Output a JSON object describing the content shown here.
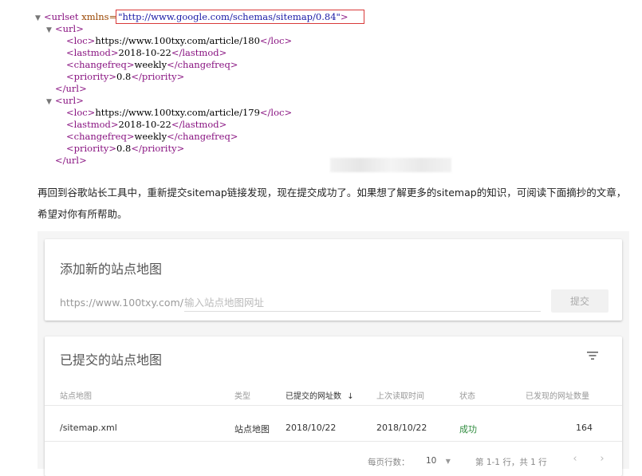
{
  "xml": {
    "lines": [
      {
        "tri": "▼",
        "open": "<urlset ",
        "attr": "xmlns=",
        "val": "\"http://www.google.com/schemas/sitemap/0.84\"",
        "close": ">",
        "text": ""
      },
      {
        "tri": "▼",
        "open": "<url>",
        "text": "",
        "close": ""
      },
      {
        "tri": "",
        "open": "<loc>",
        "text": "https://www.100txy.com/article/180",
        "close": "</loc>"
      },
      {
        "tri": "",
        "open": "<lastmod>",
        "text": "2018-10-22",
        "close": "</lastmod>"
      },
      {
        "tri": "",
        "open": "<changefreq>",
        "text": "weekly",
        "close": "</changefreq>"
      },
      {
        "tri": "",
        "open": "<priority>",
        "text": "0.8",
        "close": "</priority>"
      },
      {
        "tri": "",
        "open": "</url>",
        "text": "",
        "close": ""
      },
      {
        "tri": "▼",
        "open": "<url>",
        "text": "",
        "close": ""
      },
      {
        "tri": "",
        "open": "<loc>",
        "text": "https://www.100txy.com/article/179",
        "close": "</loc>"
      },
      {
        "tri": "",
        "open": "<lastmod>",
        "text": "2018-10-22",
        "close": "</lastmod>"
      },
      {
        "tri": "",
        "open": "<changefreq>",
        "text": "weekly",
        "close": "</changefreq>"
      },
      {
        "tri": "",
        "open": "<priority>",
        "text": "0.8",
        "close": "</priority>"
      },
      {
        "tri": "",
        "open": "</url>",
        "text": "",
        "close": ""
      }
    ]
  },
  "paragraph": "再回到谷歌站长工具中，重新提交sitemap链接发现，现在提交成功了。如果想了解更多的sitemap的知识，可阅读下面摘抄的文章，希望对你有所帮助。",
  "add_card": {
    "title": "添加新的站点地图",
    "prefix": "https://www.100txy.com/",
    "input_value": "",
    "input_placeholder": "输入站点地图网址",
    "submit_label": "提交"
  },
  "submitted_card": {
    "title": "已提交的站点地图",
    "filter_icon": "filter-icon",
    "columns": [
      "站点地图",
      "类型",
      "已提交的网址数",
      "上次读取时间",
      "状态",
      "已发现的网址数量"
    ],
    "sort_arrow": "↓",
    "rows": [
      {
        "sitemap": "/sitemap.xml",
        "type": "站点地图",
        "submitted": "2018/10/22",
        "last_read": "2018/10/22",
        "status": "成功",
        "discovered": "164"
      }
    ],
    "pager": {
      "rows_per_page_label": "每页行数：",
      "rows_per_page_value": "10",
      "range": "第 1-1 行，共 1 行",
      "prev": "‹",
      "next": "›"
    },
    "status_color": "#2e8b3d"
  }
}
